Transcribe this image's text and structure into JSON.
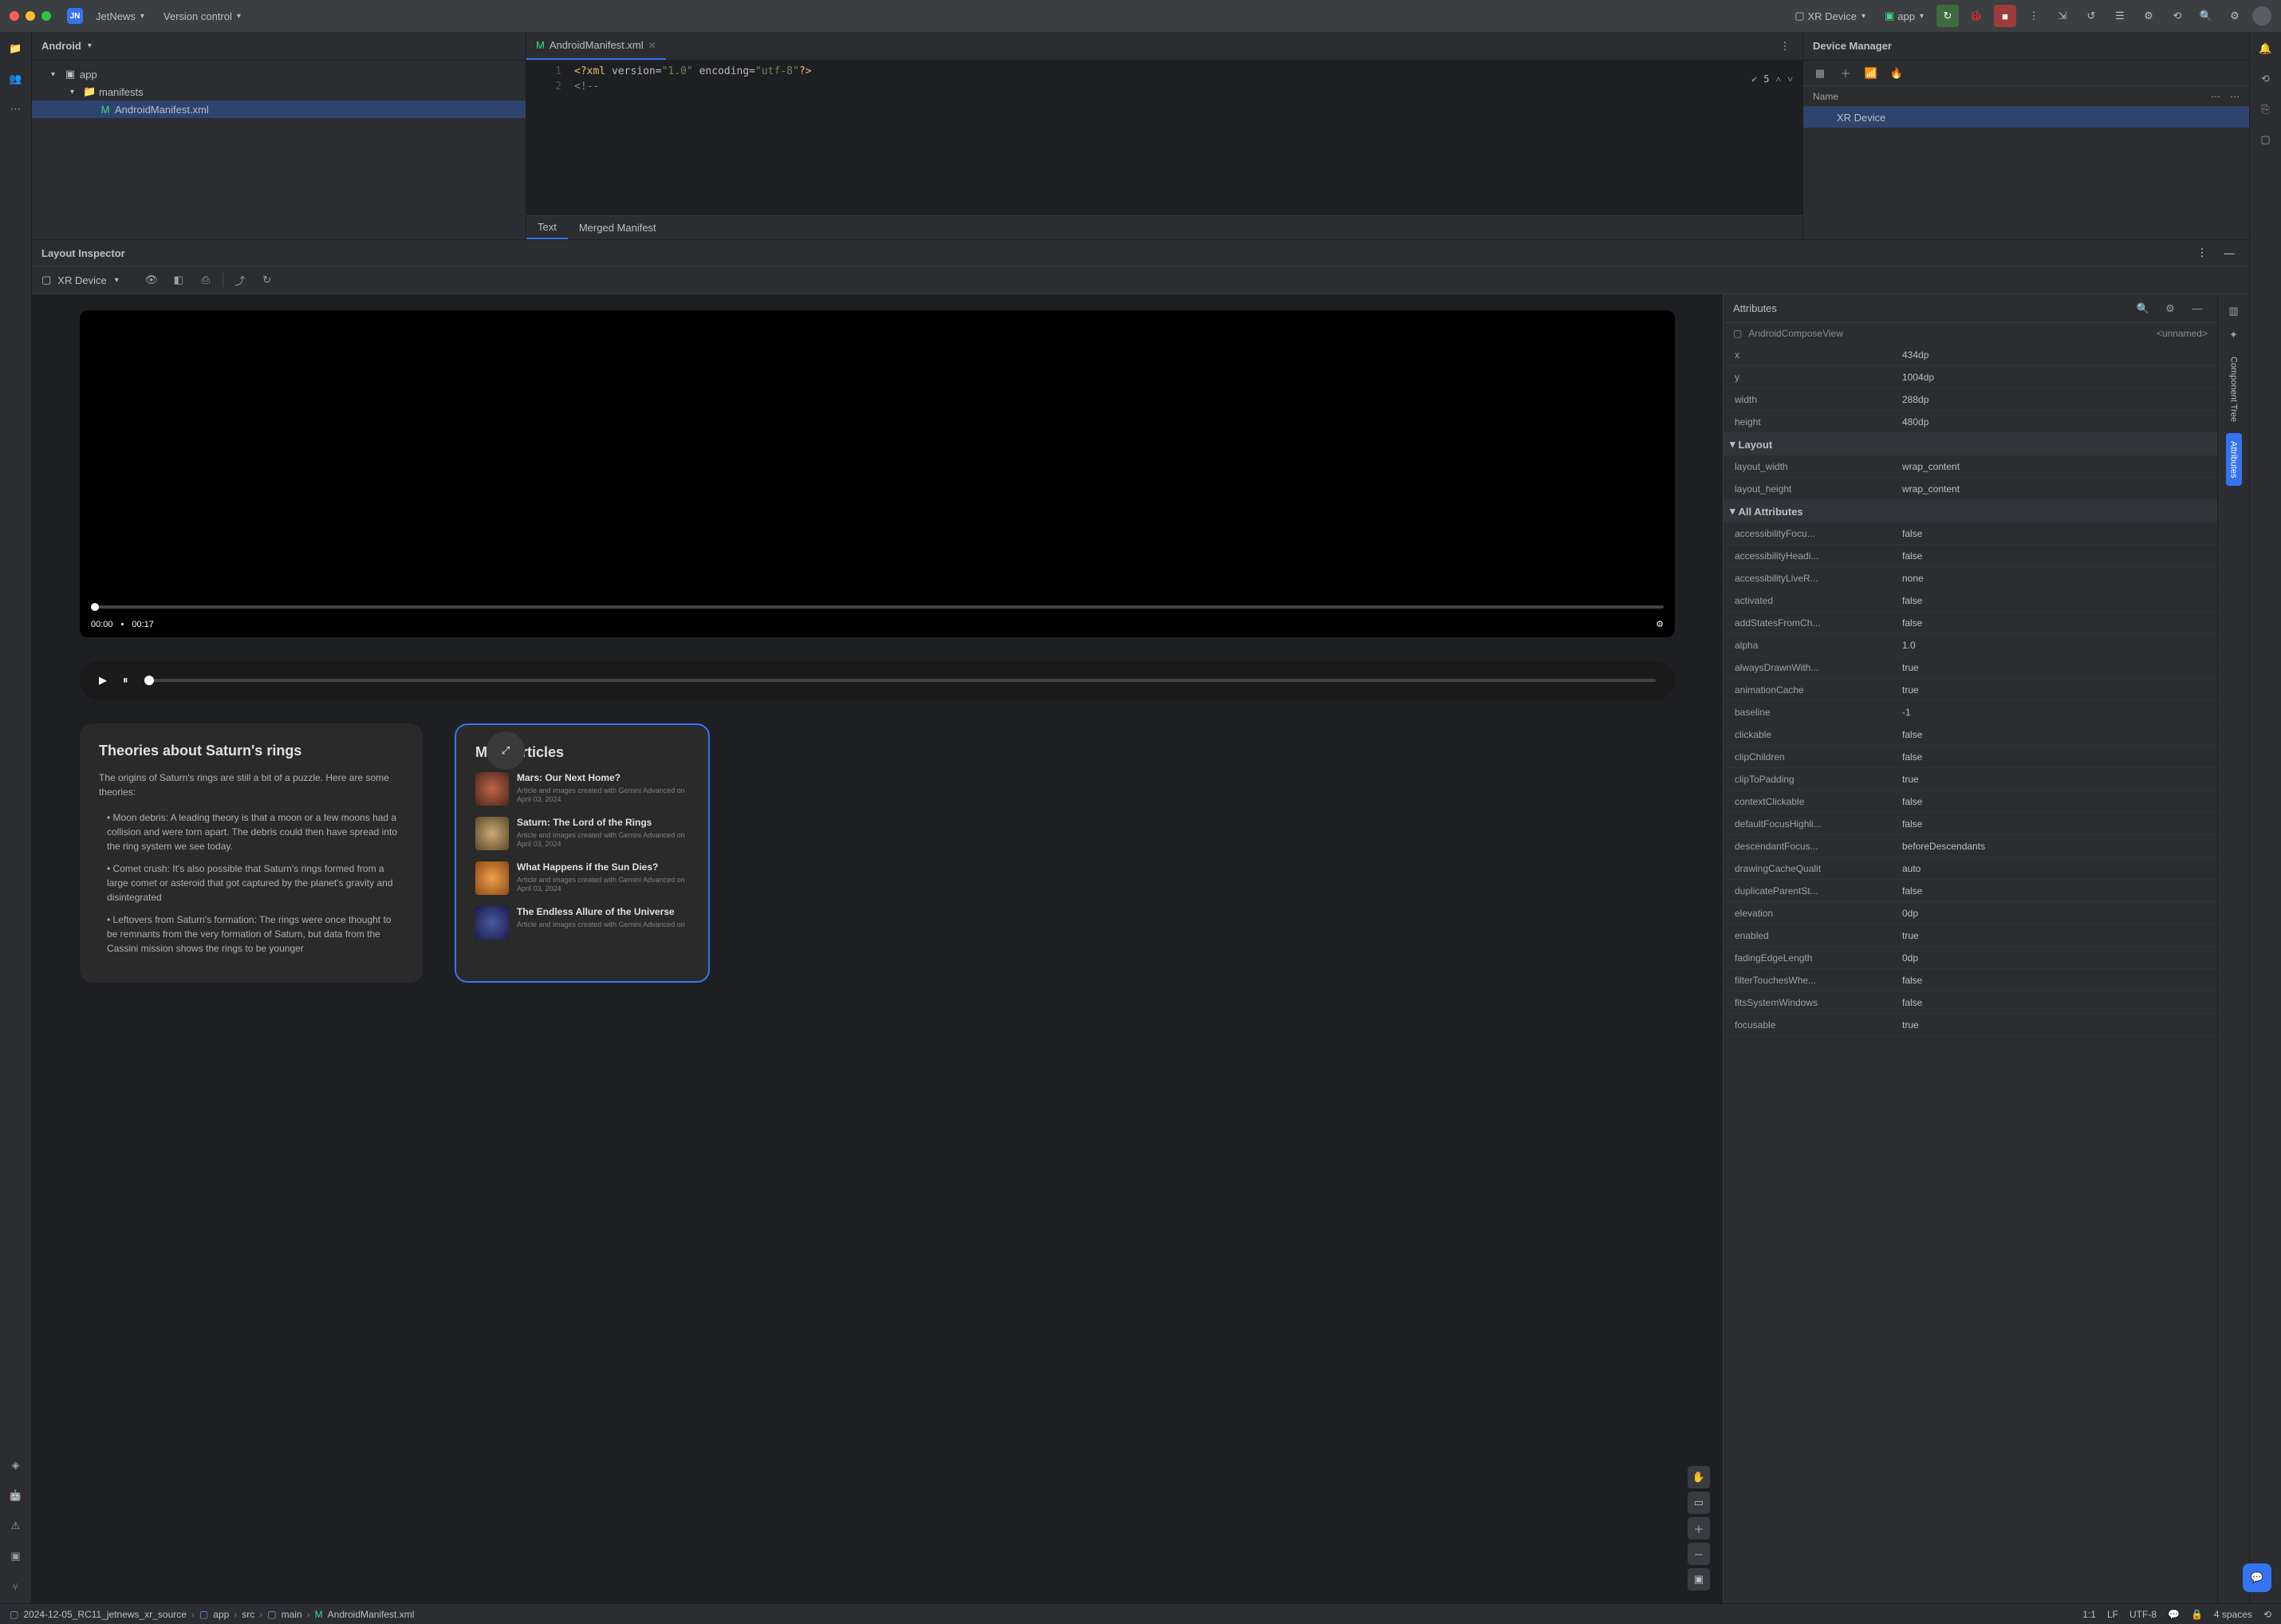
{
  "titlebar": {
    "project_badge": "JN",
    "project_name": "JetNews",
    "vcs_label": "Version control",
    "device_label": "XR Device",
    "config_label": "app"
  },
  "project_panel": {
    "header": "Android",
    "tree": {
      "root": "app",
      "manifests": "manifests",
      "manifest_file": "AndroidManifest.xml"
    }
  },
  "editor": {
    "tab_label": "AndroidManifest.xml",
    "line1": "<?xml version=\"1.0\" encoding=\"utf-8\"?>",
    "line2": "<!--",
    "line_numbers": {
      "l1": "1",
      "l2": "2"
    },
    "problems": "5",
    "sub_tabs": {
      "text": "Text",
      "merged": "Merged Manifest"
    }
  },
  "device_manager": {
    "title": "Device Manager",
    "col_name": "Name",
    "device": "XR Device"
  },
  "layout_inspector": {
    "title": "Layout Inspector",
    "device": "XR Device"
  },
  "attributes_panel": {
    "title": "Attributes",
    "view_name": "AndroidComposeView",
    "unnamed": "<unnamed>",
    "basic": [
      {
        "key": "x",
        "val": "434dp"
      },
      {
        "key": "y",
        "val": "1004dp"
      },
      {
        "key": "width",
        "val": "288dp"
      },
      {
        "key": "height",
        "val": "480dp"
      }
    ],
    "layout_section": "Layout",
    "layout": [
      {
        "key": "layout_width",
        "val": "wrap_content"
      },
      {
        "key": "layout_height",
        "val": "wrap_content"
      }
    ],
    "all_section": "All Attributes",
    "all": [
      {
        "key": "accessibilityFocu...",
        "val": "false"
      },
      {
        "key": "accessibilityHeadi...",
        "val": "false"
      },
      {
        "key": "accessibilityLiveR...",
        "val": "none"
      },
      {
        "key": "activated",
        "val": "false"
      },
      {
        "key": "addStatesFromCh...",
        "val": "false"
      },
      {
        "key": "alpha",
        "val": "1.0"
      },
      {
        "key": "alwaysDrawnWith...",
        "val": "true"
      },
      {
        "key": "animationCache",
        "val": "true"
      },
      {
        "key": "baseline",
        "val": "-1"
      },
      {
        "key": "clickable",
        "val": "false"
      },
      {
        "key": "clipChildren",
        "val": "false"
      },
      {
        "key": "clipToPadding",
        "val": "true"
      },
      {
        "key": "contextClickable",
        "val": "false"
      },
      {
        "key": "defaultFocusHighli...",
        "val": "false"
      },
      {
        "key": "descendantFocus...",
        "val": "beforeDescendants"
      },
      {
        "key": "drawingCacheQualit",
        "val": "auto"
      },
      {
        "key": "duplicateParentSt...",
        "val": "false"
      },
      {
        "key": "elevation",
        "val": "0dp"
      },
      {
        "key": "enabled",
        "val": "true"
      },
      {
        "key": "fadingEdgeLength",
        "val": "0dp"
      },
      {
        "key": "filterTouchesWhe...",
        "val": "false"
      },
      {
        "key": "fitsSystemWindows",
        "val": "false"
      },
      {
        "key": "focusable",
        "val": "true"
      }
    ]
  },
  "right_tabs": {
    "component_tree": "Component Tree",
    "attributes": "Attributes"
  },
  "preview": {
    "video": {
      "time_current": "00:00",
      "time_total": "00:17"
    },
    "theories_card": {
      "title": "Theories about Saturn's rings",
      "subtitle": "The origins of Saturn's rings are still a bit of a puzzle. Here are some theories:",
      "bullets": [
        "Moon debris: A leading theory is that a moon or a few moons had a collision and were torn apart. The debris could then have spread into the ring system we see today.",
        "Comet crush: It's also possible that Saturn's rings formed from a large comet or asteroid that got captured by the planet's gravity and disintegrated",
        "Leftovers from Saturn's formation: The rings were once thought to be remnants from the very formation of Saturn, but data from the Cassini mission shows the rings to be younger"
      ]
    },
    "more_card": {
      "title": "More articles",
      "items": [
        {
          "title": "Mars: Our Next Home?",
          "meta": "Article and images created with Gemini Advanced on April 03, 2024"
        },
        {
          "title": "Saturn: The Lord of the Rings",
          "meta": "Article and images created with Gemini Advanced on April 03, 2024"
        },
        {
          "title": "What Happens if the Sun Dies?",
          "meta": "Article and images created with Gemini Advanced on April 03, 2024"
        },
        {
          "title": "The Endless Allure of the Universe",
          "meta": "Article and images created with Gemini Advanced on"
        }
      ]
    }
  },
  "status_bar": {
    "crumbs": [
      "2024-12-05_RC11_jetnews_xr_source",
      "app",
      "src",
      "main",
      "AndroidManifest.xml"
    ],
    "position": "1:1",
    "line_ending": "LF",
    "encoding": "UTF-8",
    "indent": "4 spaces"
  }
}
